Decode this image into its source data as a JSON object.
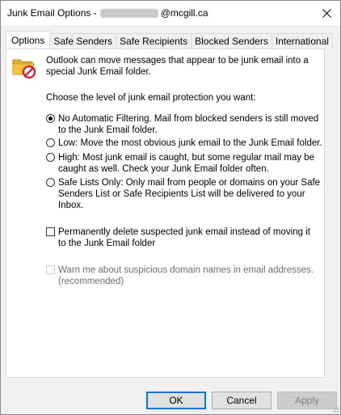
{
  "window": {
    "title_prefix": "Junk Email Options - ",
    "title_suffix": "@mcgill.ca"
  },
  "tabs": [
    {
      "label": "Options"
    },
    {
      "label": "Safe Senders"
    },
    {
      "label": "Safe Recipients"
    },
    {
      "label": "Blocked Senders"
    },
    {
      "label": "International"
    }
  ],
  "options_tab": {
    "intro": "Outlook can move messages that appear to be junk email into a special Junk Email folder.",
    "choose_label": "Choose the level of junk email protection you want:",
    "levels": [
      {
        "label": "No Automatic Filtering. Mail from blocked senders is still moved to the Junk Email folder.",
        "selected": true
      },
      {
        "label": "Low: Move the most obvious junk email to the Junk Email folder.",
        "selected": false
      },
      {
        "label": "High: Most junk email is caught, but some regular mail may be caught as well. Check your Junk Email folder often.",
        "selected": false
      },
      {
        "label": "Safe Lists Only: Only mail from people or domains on your Safe Senders List or Safe Recipients List will be delivered to your Inbox.",
        "selected": false
      }
    ],
    "permanently_delete": {
      "label": "Permanently delete suspected junk email instead of moving it to the Junk Email folder",
      "checked": false
    },
    "warn_suspicious": {
      "label": "Warn me about suspicious domain names in email addresses. (recommended)",
      "checked": false,
      "disabled": true
    }
  },
  "buttons": {
    "ok": "OK",
    "cancel": "Cancel",
    "apply": "Apply"
  },
  "icons": {
    "close": "close-icon",
    "junk": "junk-folder-icon",
    "grip": "resize-grip-icon"
  },
  "colors": {
    "accent": "#0078d7",
    "junk_badge": "#d6202e",
    "folder": "#f6c342"
  }
}
